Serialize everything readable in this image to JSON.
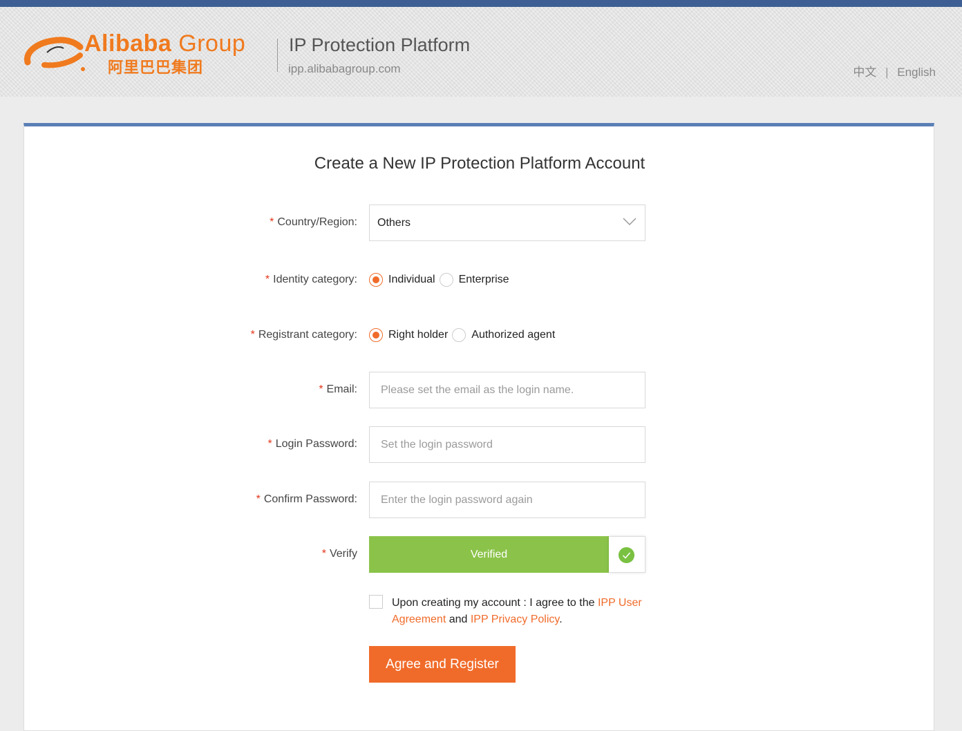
{
  "header": {
    "logo": {
      "word": "Alibaba",
      "group": "Group",
      "cn": "阿里巴巴集团"
    },
    "platform_title": "IP Protection Platform",
    "platform_url": "ipp.alibabagroup.com",
    "lang": {
      "cn": "中文",
      "sep": "|",
      "en": "English"
    }
  },
  "form": {
    "title": "Create a New IP Protection Platform Account",
    "required_mark": "*",
    "country": {
      "label": "Country/Region:",
      "value": "Others"
    },
    "identity": {
      "label": "Identity category:",
      "options": [
        "Individual",
        "Enterprise"
      ],
      "selected": "Individual"
    },
    "registrant": {
      "label": "Registrant category:",
      "options": [
        "Right holder",
        "Authorized agent"
      ],
      "selected": "Right holder"
    },
    "email": {
      "label": "Email:",
      "placeholder": "Please set the email as the login name."
    },
    "password": {
      "label": "Login Password:",
      "placeholder": "Set the login password"
    },
    "confirm": {
      "label": "Confirm Password:",
      "placeholder": "Enter the login password again"
    },
    "verify": {
      "label": "Verify",
      "status": "Verified"
    },
    "agreement": {
      "text1": "Upon creating my account : I agree to the ",
      "link1": "IPP User Agreement",
      "text2": " and ",
      "link2": "IPP Privacy Policy",
      "text3": "."
    },
    "submit": "Agree and Register"
  },
  "colors": {
    "accent": "#f06b2a",
    "top_bar": "#3d5f93",
    "verified": "#8bc34a"
  }
}
